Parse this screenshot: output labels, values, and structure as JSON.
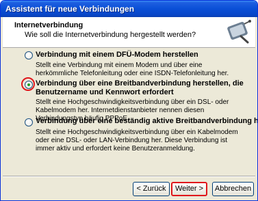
{
  "window": {
    "title": "Assistent für neue Verbindungen"
  },
  "header": {
    "title": "Internetverbindung",
    "subtitle": "Wie soll die Internetverbindung hergestellt werden?"
  },
  "options": [
    {
      "label_lines": [
        "Verbindung mit einem DFÜ-Modem herstellen"
      ],
      "description": "Stellt eine Verbindung mit einem Modem und über eine herkömmliche Telefonleitung oder eine ISDN-Telefonleitung her.",
      "selected": false
    },
    {
      "label_lines": [
        "Verbindung über eine Breitbandverbindung herstellen, die",
        "Benutzername und Kennwort erfordert"
      ],
      "description": "Stellt eine Hochgeschwindigkeitsverbindung über ein DSL- oder Kabelmodem her. Internetdienstanbieter nennen diesen Verbindungstyp häufig PPPoE.",
      "selected": true
    },
    {
      "label_lines": [
        "Verbindung über eine beständig aktive Breitbandverbindung herstellen"
      ],
      "description": "Stellt eine Hochgeschwindigkeitsverbindung über ein Kabelmodem oder eine DSL- oder LAN-Verbindung her. Diese Verbindung ist immer aktiv und erfordert keine Benutzeranmeldung.",
      "selected": false
    }
  ],
  "buttons": {
    "back": "< Zurück",
    "next": "Weiter >",
    "cancel": "Abbrechen"
  },
  "colors": {
    "titlebar": "#0a4fd6",
    "dialog_bg": "#ece9d8",
    "annotation_red": "#e0161b"
  },
  "icons": {
    "header": "network-connection-icon"
  }
}
